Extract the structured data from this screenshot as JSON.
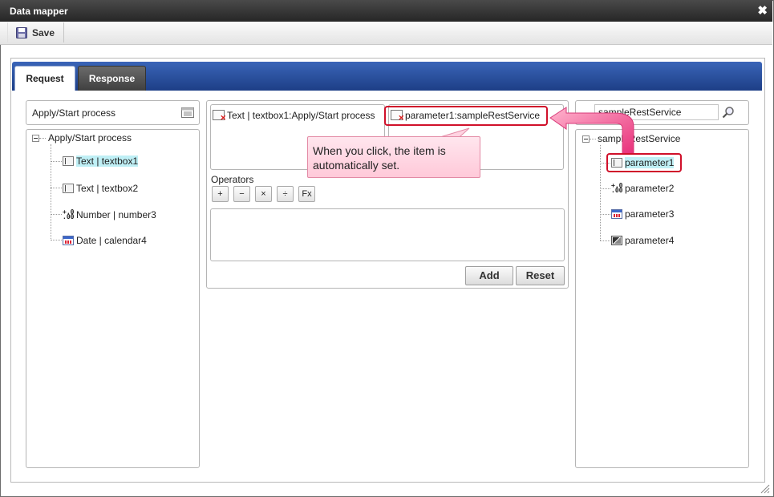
{
  "window": {
    "title": "Data mapper",
    "close_glyph": "✖"
  },
  "toolbar": {
    "save_label": "Save",
    "save_icon": "floppy-disk-icon"
  },
  "tabs": [
    {
      "label": "Request",
      "active": true
    },
    {
      "label": "Response",
      "active": false
    }
  ],
  "left_panel": {
    "header": "Apply/Start process",
    "tree": {
      "root": "Apply/Start process",
      "children": [
        {
          "label": "Text | textbox1",
          "icon": "text-field-icon",
          "selected": true
        },
        {
          "label": "Text | textbox2",
          "icon": "text-field-icon",
          "selected": false
        },
        {
          "label": "Number | number3",
          "icon": "number-icon",
          "selected": false
        },
        {
          "label": "Date | calendar4",
          "icon": "calendar-icon",
          "selected": false
        }
      ]
    }
  },
  "middle_panel": {
    "source_field": "Text | textbox1:Apply/Start process",
    "target_field": "parameter1:sampleRestService",
    "operators_label": "Operators",
    "operators": [
      "+",
      "−",
      "×",
      "÷",
      "Fx"
    ],
    "expression_value": "",
    "add_label": "Add",
    "reset_label": "Reset"
  },
  "right_panel": {
    "search_value": "sampleRestService",
    "tree": {
      "root": "sampleRestService",
      "children": [
        {
          "label": "parameter1",
          "icon": "text-field-icon",
          "selected": true
        },
        {
          "label": "parameter2",
          "icon": "number-icon",
          "selected": false
        },
        {
          "label": "parameter3",
          "icon": "calendar-icon",
          "selected": false
        },
        {
          "label": "parameter4",
          "icon": "image-icon",
          "selected": false
        }
      ]
    }
  },
  "annotation": {
    "tooltip": "When you click, the item is automatically set.",
    "highlight_color": "#d0102a",
    "arrow_color": "#ee4f8f"
  },
  "colors": {
    "tab_bar": "#2a4f9e",
    "selection": "#bfeff5"
  }
}
